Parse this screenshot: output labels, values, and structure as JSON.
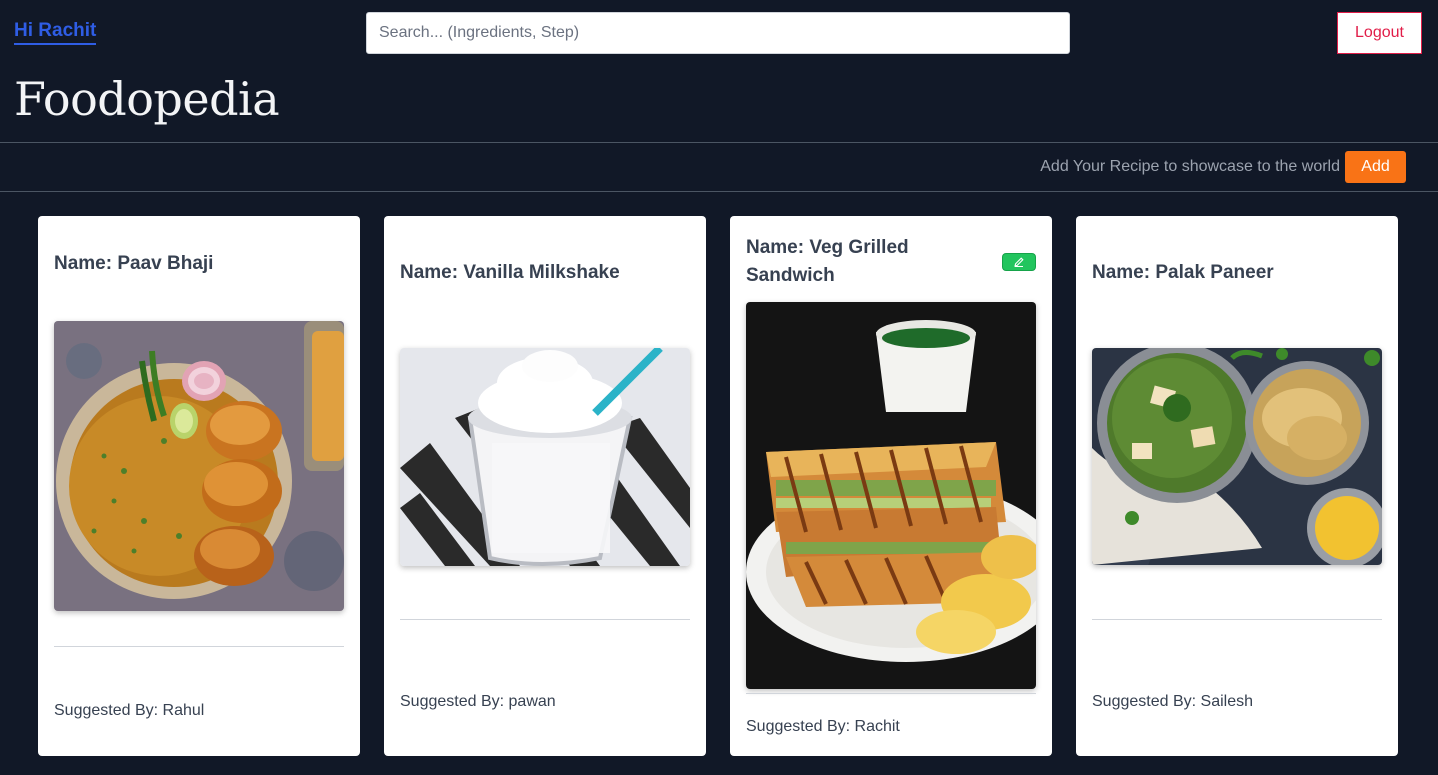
{
  "header": {
    "greeting": "Hi Rachit",
    "search_placeholder": "Search... (Ingredients, Step)",
    "search_value": "",
    "logout_label": "Logout",
    "brand": "Foodopedia"
  },
  "add_bar": {
    "text": "Add Your Recipe to showcase to the world",
    "button_label": "Add"
  },
  "colors": {
    "background": "#111827",
    "accent_blue": "#2f5de5",
    "add_orange": "#f97316",
    "logout_red": "#e11d48",
    "edit_green": "#22c55e"
  },
  "recipes": [
    {
      "title": "Name: Paav Bhaji",
      "suggested": "Suggested By: Rahul",
      "image": "paav-bhaji-photo"
    },
    {
      "title": "Name: Vanilla Milkshake",
      "suggested": "Suggested By: pawan",
      "image": "vanilla-milkshake-photo"
    },
    {
      "title": "Name: Veg Grilled Sandwich",
      "suggested": "Suggested By: Rachit",
      "image": "veg-grilled-sandwich-photo",
      "editable": true,
      "edit_icon": "pencil-icon"
    },
    {
      "title": "Name: Palak Paneer",
      "suggested": "Suggested By: Sailesh",
      "image": "palak-paneer-photo"
    }
  ]
}
